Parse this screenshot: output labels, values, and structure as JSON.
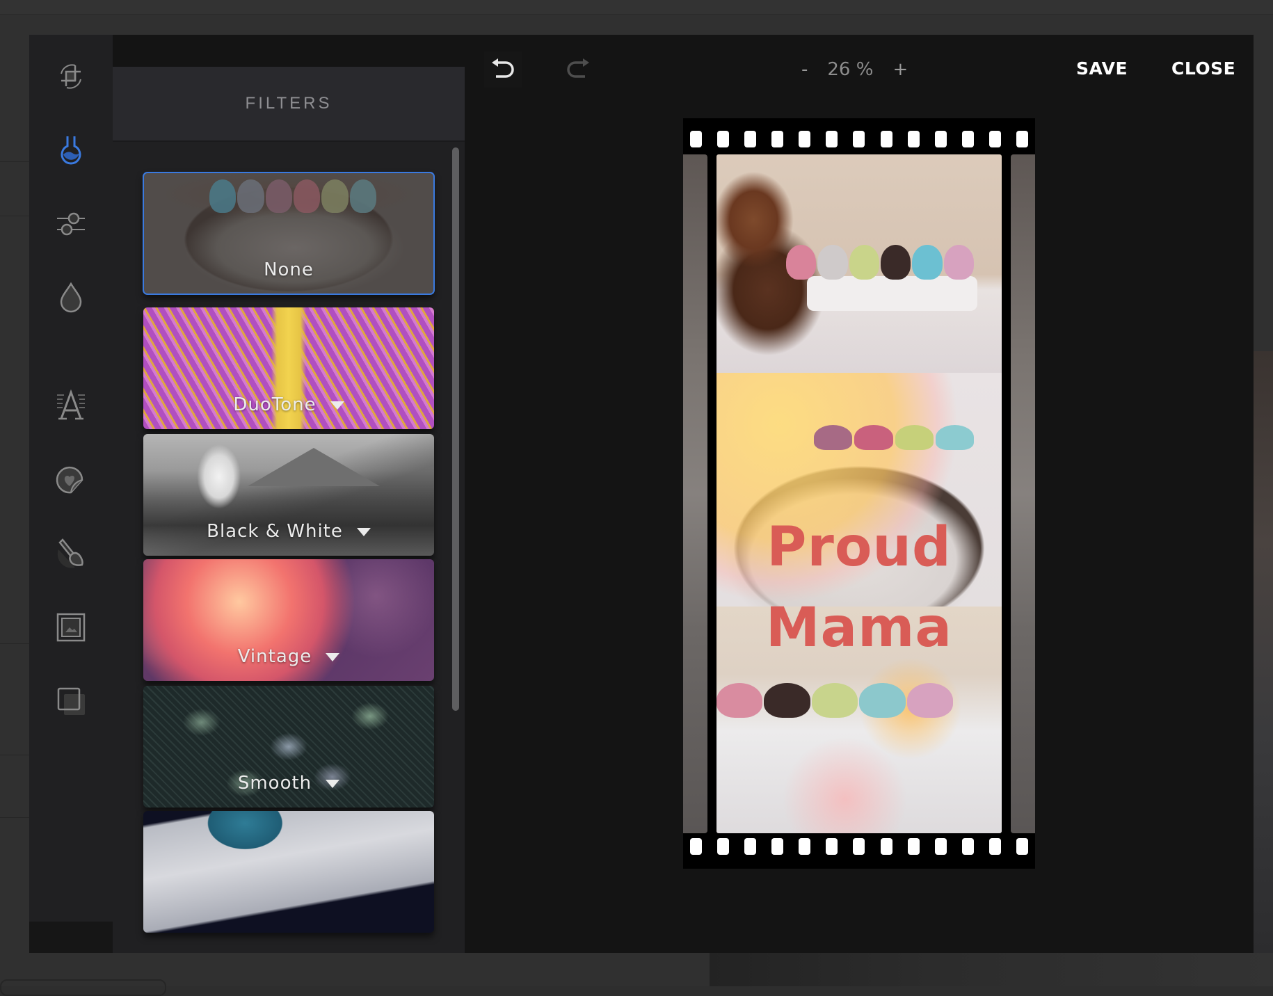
{
  "toolbar": {
    "undo_icon": "undo-icon",
    "redo_icon": "redo-icon",
    "zoom_out": "-",
    "zoom_level": "26 %",
    "zoom_in": "+",
    "save_label": "SAVE",
    "close_label": "CLOSE"
  },
  "sidebar": {
    "items": [
      {
        "id": "crop",
        "icon": "crop-rotate-icon",
        "active": false
      },
      {
        "id": "filters",
        "icon": "flask-icon",
        "active": true
      },
      {
        "id": "adjust",
        "icon": "sliders-icon",
        "active": false
      },
      {
        "id": "focus",
        "icon": "drop-icon",
        "active": false
      },
      {
        "id": "text",
        "icon": "text-icon",
        "active": false
      },
      {
        "id": "stickers",
        "icon": "sticker-icon",
        "active": false
      },
      {
        "id": "brush",
        "icon": "brush-icon",
        "active": false
      },
      {
        "id": "frames",
        "icon": "frame-icon",
        "active": false
      },
      {
        "id": "overlays",
        "icon": "overlay-icon",
        "active": false
      }
    ],
    "accent_color": "#3a7ae0"
  },
  "filters": {
    "title": "FILTERS",
    "items": [
      {
        "label": "None",
        "selected": true,
        "has_dropdown": false
      },
      {
        "label": "DuoTone",
        "selected": false,
        "has_dropdown": true
      },
      {
        "label": "Black & White",
        "selected": false,
        "has_dropdown": true
      },
      {
        "label": "Vintage",
        "selected": false,
        "has_dropdown": true
      },
      {
        "label": "Smooth",
        "selected": false,
        "has_dropdown": true
      },
      {
        "label": "",
        "selected": false,
        "has_dropdown": false
      }
    ]
  },
  "canvas": {
    "overlay_text_line1": "Proud",
    "overlay_text_line2": "Mama",
    "text_color": "#d95c56",
    "film_holes_per_row": 13
  }
}
